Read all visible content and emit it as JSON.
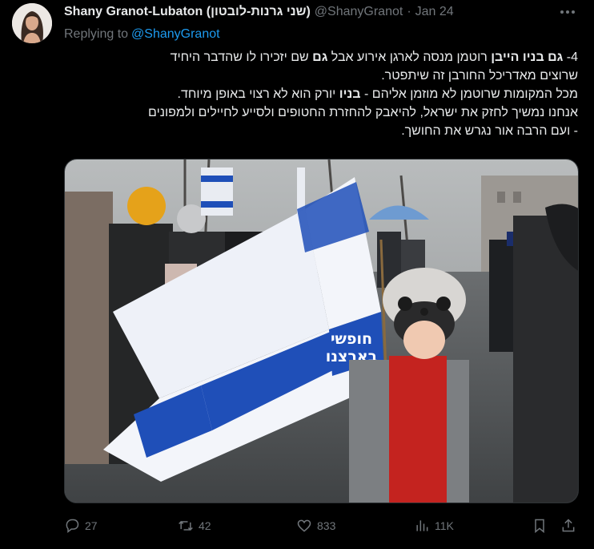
{
  "author": {
    "display_name": "Shany Granot-Lubaton (שני גרנות-לובטון)",
    "handle": "@ShanyGranot",
    "separator": "·",
    "date": "Jan 24"
  },
  "replying": {
    "prefix": "Replying to",
    "mention": "@ShanyGranot"
  },
  "tweet": {
    "line1_prefix": "4- ",
    "line1_bold1": "גם בניו הייבן",
    "line1_mid": " רוטמן מנסה לארגן אירוע אבל ",
    "line1_bold2": "גם",
    "line1_end": " שם יזכירו לו שהדבר היחיד",
    "line2": "שרוצים מאדריכל החורבן זה שיתפטר.",
    "line3_start": "מכל המקומות שרוטמן לא מוזמן אליהם - ",
    "line3_bold": "בניו",
    "line3_end": " יורק הוא לא רצוי באופן מיוחד.",
    "line4": "אנחנו נמשיך לחזק את ישראל, להיאבק להחזרת החטופים ולסייע לחיילים ולמפונים",
    "line5": "- ועם הרבה אור נגרש את החושך."
  },
  "media": {
    "flag_text_line1": "חופשי",
    "flag_text_line2": "בארצנו",
    "icon": "photo"
  },
  "actions": {
    "replies": "27",
    "reposts": "42",
    "likes": "833",
    "views": "11K"
  },
  "colors": {
    "background": "#000000",
    "text": "#e7e9ea",
    "secondary": "#71767b",
    "link": "#1d9bf0",
    "flag_blue": "#1f4fb8"
  }
}
